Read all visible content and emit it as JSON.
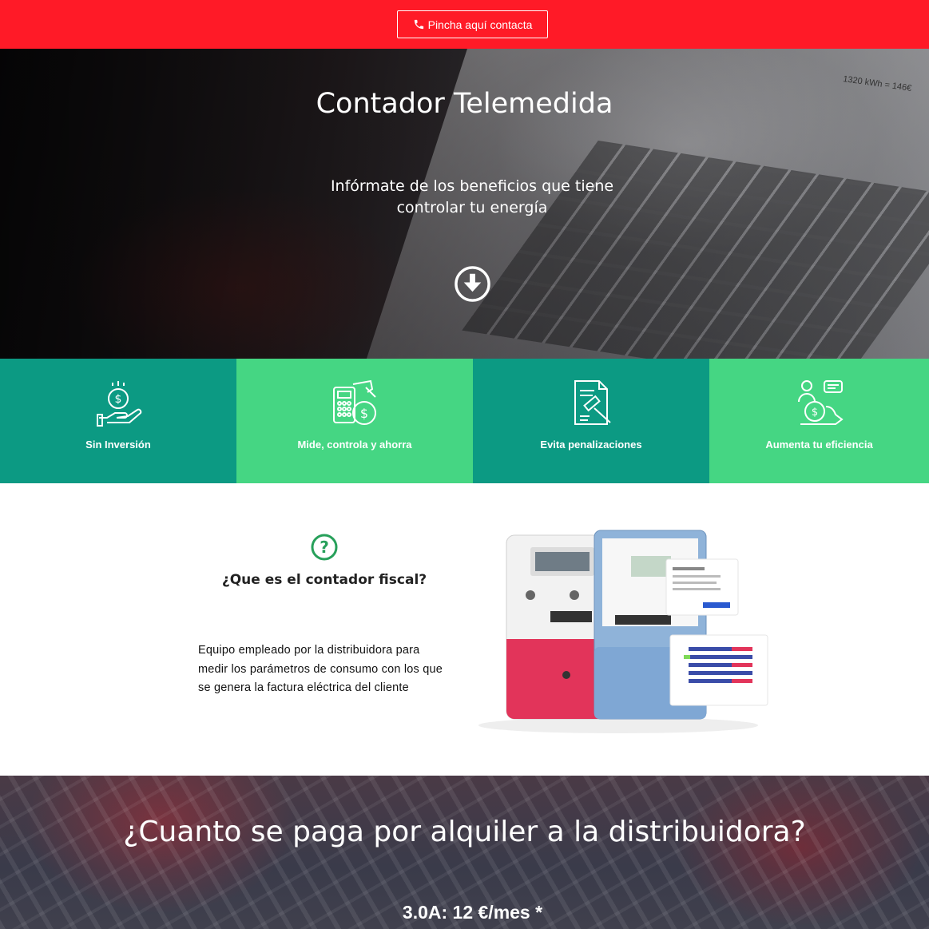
{
  "topbar": {
    "contact_label": "Pincha aquí contacta",
    "color": "#ff1a27"
  },
  "hero": {
    "title": "Contador Telemedida",
    "subtitle": "Infórmate de los beneficios que tiene controlar tu energía",
    "screen_reading": "1320 kWh = 146€"
  },
  "features": [
    {
      "label": "Sin Inversión",
      "icon": "hand-coin-icon",
      "color": "#0c9a83"
    },
    {
      "label": "Mide, controla y ahorra",
      "icon": "calculator-coin-icon",
      "color": "#45d683"
    },
    {
      "label": "Evita penalizaciones",
      "icon": "document-gavel-icon",
      "color": "#0c9a83"
    },
    {
      "label": "Aumenta tu eficiencia",
      "icon": "person-growth-icon",
      "color": "#45d683"
    }
  ],
  "about": {
    "title": "¿Que es el contador fiscal?",
    "text": "Equipo empleado por la distribuidora para medir los parámetros de consumo con los que se genera la factura eléctrica del cliente"
  },
  "bottom": {
    "title": "¿Cuanto se paga por alquiler a la distribuidora?",
    "price": "3.0A: 12 €/mes *"
  }
}
